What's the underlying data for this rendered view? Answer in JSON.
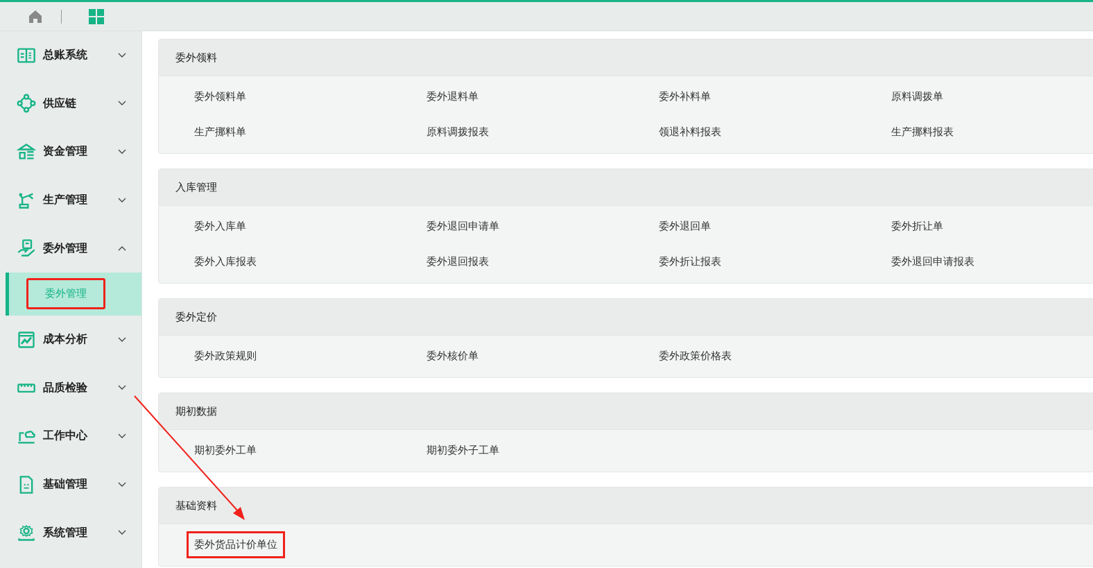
{
  "topbar": {
    "tabs": [
      {
        "kind": "home",
        "selected": false
      },
      {
        "kind": "grid",
        "selected": true
      }
    ]
  },
  "sidebar": {
    "items": [
      {
        "label": "总账系统",
        "expanded": false
      },
      {
        "label": "供应链",
        "expanded": false
      },
      {
        "label": "资金管理",
        "expanded": false
      },
      {
        "label": "生产管理",
        "expanded": false
      },
      {
        "label": "委外管理",
        "expanded": true,
        "children": [
          {
            "label": "委外管理",
            "selected": true,
            "highlighted": true
          }
        ]
      },
      {
        "label": "成本分析",
        "expanded": false
      },
      {
        "label": "品质检验",
        "expanded": false
      },
      {
        "label": "工作中心",
        "expanded": false
      },
      {
        "label": "基础管理",
        "expanded": false
      },
      {
        "label": "系统管理",
        "expanded": false
      }
    ]
  },
  "sections": [
    {
      "title": "委外领料",
      "links": [
        {
          "label": "委外领料单",
          "highlighted": false
        },
        {
          "label": "委外退料单",
          "highlighted": false
        },
        {
          "label": "委外补料单",
          "highlighted": false
        },
        {
          "label": "原料调拨单",
          "highlighted": false
        },
        {
          "label": "生产挪料单",
          "highlighted": false
        },
        {
          "label": "原料调拨报表",
          "highlighted": false
        },
        {
          "label": "领退补料报表",
          "highlighted": false
        },
        {
          "label": "生产挪料报表",
          "highlighted": false
        }
      ]
    },
    {
      "title": "入库管理",
      "links": [
        {
          "label": "委外入库单",
          "highlighted": false
        },
        {
          "label": "委外退回申请单",
          "highlighted": false
        },
        {
          "label": "委外退回单",
          "highlighted": false
        },
        {
          "label": "委外折让单",
          "highlighted": false
        },
        {
          "label": "委外入库报表",
          "highlighted": false
        },
        {
          "label": "委外退回报表",
          "highlighted": false
        },
        {
          "label": "委外折让报表",
          "highlighted": false
        },
        {
          "label": "委外退回申请报表",
          "highlighted": false
        }
      ]
    },
    {
      "title": "委外定价",
      "links": [
        {
          "label": "委外政策规则",
          "highlighted": false
        },
        {
          "label": "委外核价单",
          "highlighted": false
        },
        {
          "label": "委外政策价格表",
          "highlighted": false
        }
      ]
    },
    {
      "title": "期初数据",
      "links": [
        {
          "label": "期初委外工单",
          "highlighted": false
        },
        {
          "label": "期初委外子工单",
          "highlighted": false
        }
      ]
    },
    {
      "title": "基础资料",
      "links": [
        {
          "label": "委外货品计价单位",
          "highlighted": true
        }
      ]
    }
  ],
  "annotation": {
    "arrow": true
  }
}
